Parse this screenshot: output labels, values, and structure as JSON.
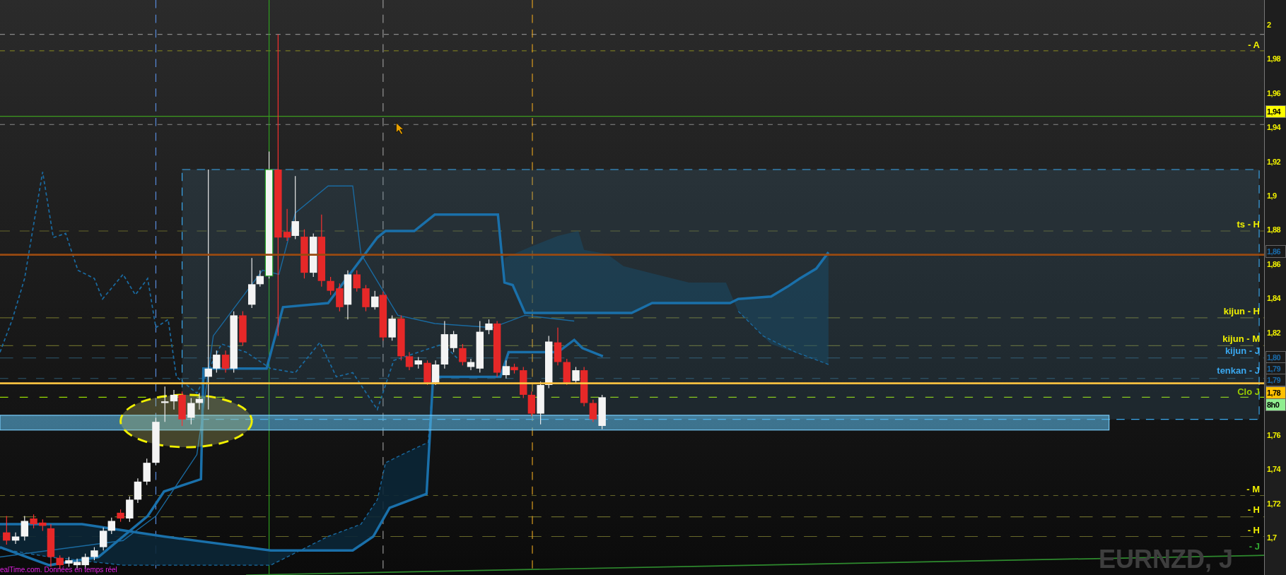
{
  "chart": {
    "symbol": "EURNZD, J",
    "source": "ealTime.com. Données en temps réel",
    "level_labels": [
      {
        "text": "- A",
        "color": "#f0f000"
      },
      {
        "text": "ts - H",
        "color": "#f0f000"
      },
      {
        "text": "kijun - H",
        "color": "#f0f000"
      },
      {
        "text": "kijun - M",
        "color": "#f0f000"
      },
      {
        "text": "kijun - J",
        "color": "#3aa8f0"
      },
      {
        "text": "tenkan - J",
        "color": "#3aa8f0"
      },
      {
        "text": "Clo J",
        "color": "#99cc00"
      },
      {
        "text": "- M",
        "color": "#f0f000"
      },
      {
        "text": "- H",
        "color": "#f0f000"
      },
      {
        "text": "- H",
        "color": "#f0f000"
      },
      {
        "text": "- J",
        "color": "#33aa33"
      }
    ]
  },
  "price_axis": {
    "ticks": [
      "2",
      "1,98",
      "1,96",
      "1,94",
      "1,92",
      "1,9",
      "1,88",
      "1,86",
      "1,84",
      "1,82",
      "1,76",
      "1,74",
      "1,72",
      "1,7"
    ],
    "tags": [
      {
        "text": "1,94",
        "color": "#ffff00"
      },
      {
        "text": "1,86",
        "color": "#1a1a1a"
      },
      {
        "text": "1,80",
        "color": "#1a1a1a"
      },
      {
        "text": "1,79",
        "color": "#1a1a1a"
      },
      {
        "text": "1,79",
        "color": "#1a1a1a"
      },
      {
        "text": "1,78",
        "color": "#ffc000"
      },
      {
        "text": "8h0",
        "color": "#90ee90"
      }
    ]
  }
}
